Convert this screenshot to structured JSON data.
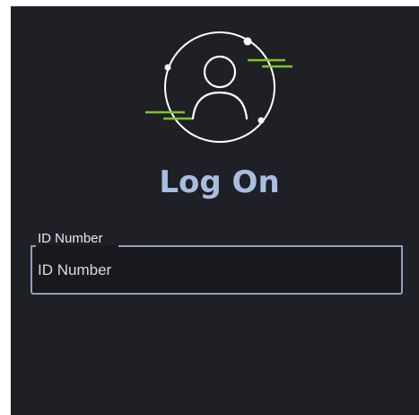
{
  "page": {
    "title": "Log On"
  },
  "login_form": {
    "id_field": {
      "label": "ID Number",
      "placeholder": "ID Number",
      "value": ""
    }
  },
  "icons": {
    "logo": "user-circle-icon"
  },
  "colors": {
    "background": "#1f1f26",
    "title": "#a9bde0",
    "accent_green": "#7ac52b",
    "field_border": "#8ea0bd",
    "field_background": "#18181d"
  }
}
